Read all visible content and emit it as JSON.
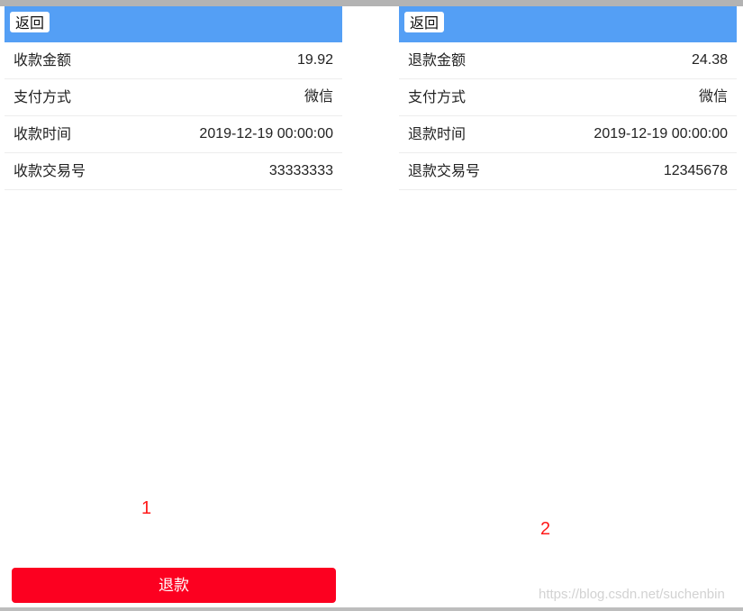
{
  "panels": [
    {
      "back_label": "返回",
      "rows": [
        {
          "label": "收款金额",
          "value": "19.92"
        },
        {
          "label": "支付方式",
          "value": "微信"
        },
        {
          "label": "收款时间",
          "value": "2019-12-19 00:00:00"
        },
        {
          "label": "收款交易号",
          "value": "33333333"
        }
      ],
      "page_number": "1",
      "refund_label": "退款"
    },
    {
      "back_label": "返回",
      "rows": [
        {
          "label": "退款金额",
          "value": "24.38"
        },
        {
          "label": "支付方式",
          "value": "微信"
        },
        {
          "label": "退款时间",
          "value": "2019-12-19 00:00:00"
        },
        {
          "label": "退款交易号",
          "value": "12345678"
        }
      ],
      "page_number": "2"
    }
  ],
  "watermark": "https://blog.csdn.net/suchenbin",
  "colors": {
    "header_bg": "#549ff5",
    "refund_button_bg": "#fc0020",
    "annotation_number": "#ff1a1a"
  }
}
